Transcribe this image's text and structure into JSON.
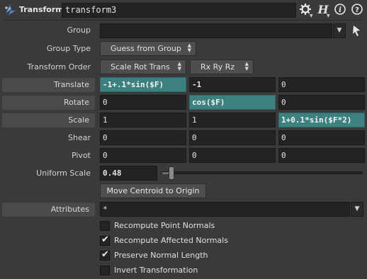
{
  "header": {
    "node_type": "Transform",
    "node_name": "transform3",
    "icons": [
      "transform-node-icon",
      "gear-icon",
      "help-h-icon",
      "info-icon",
      "help-icon"
    ]
  },
  "group": {
    "label": "Group",
    "value": ""
  },
  "group_type": {
    "label": "Group Type",
    "value": "Guess from Group"
  },
  "transform_order": {
    "label": "Transform Order",
    "value": "Scale Rot Trans",
    "rot_order": "Rx Ry Rz"
  },
  "translate": {
    "label": "Translate",
    "x": "-1+.1*sin($F)",
    "y": "-1",
    "z": "0"
  },
  "rotate": {
    "label": "Rotate",
    "x": "0",
    "y": "cos($F)",
    "z": "0"
  },
  "scale": {
    "label": "Scale",
    "x": "1",
    "y": "1",
    "z": "1+0.1*sin($F*2)"
  },
  "shear": {
    "label": "Shear",
    "x": "0",
    "y": "0",
    "z": "0"
  },
  "pivot": {
    "label": "Pivot",
    "x": "0",
    "y": "0",
    "z": "0"
  },
  "uniform_scale": {
    "label": "Uniform Scale",
    "value": "0.48",
    "slider_fraction": 0.048
  },
  "move_centroid_button": "Move Centroid to Origin",
  "attributes": {
    "label": "Attributes",
    "value": "*"
  },
  "checkboxes": [
    {
      "label": "Recompute Point Normals",
      "checked": false
    },
    {
      "label": "Recompute Affected Normals",
      "checked": true
    },
    {
      "label": "Preserve Normal Length",
      "checked": true
    },
    {
      "label": "Invert Transformation",
      "checked": false
    }
  ],
  "colors": {
    "expression_highlight": "#3c8080",
    "background": "#3a3a3a",
    "field": "#232323"
  }
}
